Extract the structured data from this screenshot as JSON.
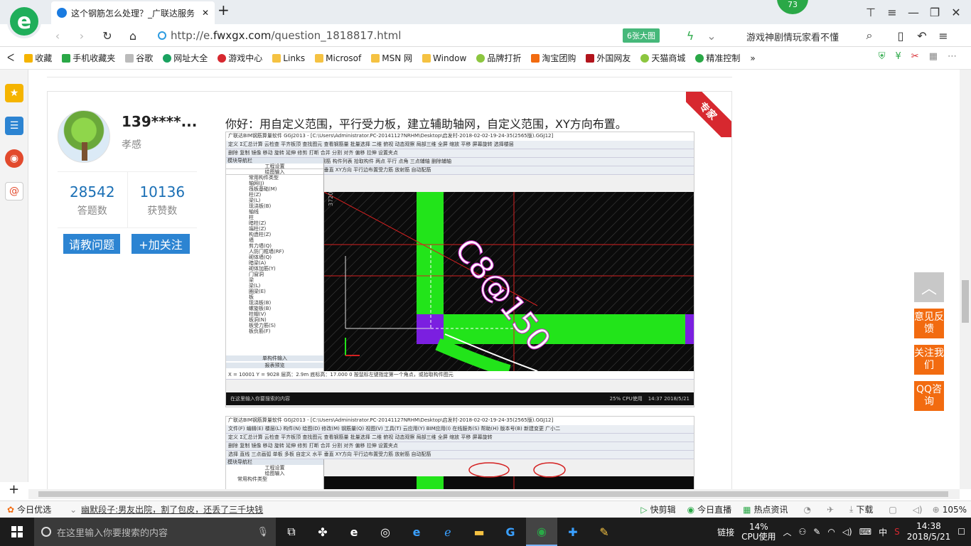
{
  "browser": {
    "tab_title": "这个钢筋怎么处理？_广联达服务",
    "tab_close": "✕",
    "new_tab": "+",
    "badge": "73",
    "url_prefix": "http://e.",
    "url_domain": "fwxgx.com",
    "url_path": "/question_1818817.html",
    "images_count": "6张大图",
    "search_hint": "游戏神剧情玩家看不懂"
  },
  "bookmarks": [
    {
      "label": "收藏",
      "color": "#f5b400"
    },
    {
      "label": "手机收藏夹",
      "color": "#2aa847"
    },
    {
      "label": "谷歌",
      "color": "#999999"
    },
    {
      "label": "网址大全",
      "color": "#1aa260"
    },
    {
      "label": "游戏中心",
      "color": "#d7282f"
    },
    {
      "label": "Links",
      "color": "#f5c242"
    },
    {
      "label": "Microsof",
      "color": "#f5c242"
    },
    {
      "label": "MSN 网",
      "color": "#f5c242"
    },
    {
      "label": "Window",
      "color": "#f5c242"
    },
    {
      "label": "品牌打折",
      "color": "#8cc63f"
    },
    {
      "label": "淘宝团购",
      "color": "#f26b10"
    },
    {
      "label": "外国网友",
      "color": "#b2141c"
    },
    {
      "label": "天猫商城",
      "color": "#8cc63f"
    },
    {
      "label": "精准控制",
      "color": "#2aa847"
    }
  ],
  "bookmarks_more": "»",
  "answer": {
    "username": "139****...",
    "location": "孝感",
    "expert_label": "专家",
    "answers_count": "28542",
    "answers_label": "答题数",
    "likes_count": "10136",
    "likes_label": "获赞数",
    "ask_button": "请教问题",
    "follow_button": "+加关注",
    "text": "你好：用自定义范围，平行受力板，建立辅助轴网，自定义范围，XY方向布置。"
  },
  "screenshot1": {
    "title": "广联达BIM钢筋算量软件 GGJ2013 - [C:\\Users\\Administrator.PC-20141127NRHM\\Desktop\\启发村-2018-02-02-19-24-35(2565版).GGJ12]",
    "toolbar1": "定义  Σ汇总计算  云检查  平齐板顶  查找图元  查看钢筋量  批量选择  二维  俯视  动态观察  局部三维  全屏  缩放  平移  屏幕旋转  选择楼层",
    "toolbar2": "删除  复制  镜像  移动  旋转  延伸  修剪  打断  合并  分割  对齐  偏移  拉伸  设置夹点",
    "toolbar3": "第0层  板  受力筋  SLJ-2  分层板1  属性  编辑钢筋  构件列表  拾取构件  两点  平行  点角  三点辅轴  删除辅轴",
    "toolbar4": "选择  直线  三点画弧  单板  多板  自定义  水平  垂直  XY方向  平行边布置受力筋  放射筋  自动配筋",
    "tree_title": "模块导航栏",
    "tree_tab1": "工程设置",
    "tree_tab2": "绘图输入",
    "tree": [
      "常用构件类型",
      "轴网(J)",
      "筏板基础(M)",
      "柱(Z)",
      "梁(L)",
      "现浇板(B)",
      "轴线",
      "柱",
      "暗柱(Z)",
      "端柱(Z)",
      "构造柱(Z)",
      "墙",
      "剪力墙(Q)",
      "人防门框墙(RF)",
      "砌体墙(Q)",
      "暗梁(A)",
      "砌体加筋(Y)",
      "门窗洞",
      "梁",
      "梁(L)",
      "圈梁(E)",
      "板",
      "现浇板(B)",
      "螺旋板(B)",
      "柱帽(V)",
      "板洞(N)",
      "板受力筋(S)",
      "板负筋(F)"
    ],
    "tree_bottom1": "单构件输入",
    "tree_bottom2": "报表预览",
    "rebar_label": "C8@150",
    "axis_num": "3720",
    "status": "X = 10001  Y = 9028  层高：2.9m  底标高：17.000  0  按鼠标左键指定第一个角点，或拾取构件图元",
    "taskbar": "在这里输入你要搜索的内容",
    "cpu": "25% CPU使用",
    "time": "14:37 2018/5/21"
  },
  "screenshot2": {
    "title": "广联达BIM钢筋算量软件 GGJ2013 - [C:\\Users\\Administrator.PC-20141127NRHM\\Desktop\\启发村-2018-02-02-19-24-35(2565版).GGJ12]",
    "toolbar1": "文件(F)  编辑(E)  楼层(L)  构件(N)  绘图(D)  修改(M)  钢筋量(Q)  视图(V)  工具(T)  云应用(Y)  BIM应用(I)  在线服务(S)  帮助(H)  版本号(B)  新建变更  广小二",
    "toolbar2": "定义  Σ汇总计算  云检查  平齐板顶  查找图元  查看钢筋量  批量选择  二维  俯视  动态观察  局部三维  全屏  缩放  平移  屏幕旋转",
    "toolbar3": "删除  复制  镜像  移动  旋转  延伸  修剪  打断  合并  分割  对齐  偏移  拉伸  设置夹点",
    "toolbar4": "选择  直线  三点画弧  单板  多板  自定义  水平  垂直  XY方向  平行边布置受力筋  放射筋  自动配筋",
    "tree_title": "模块导航栏",
    "tree_tab1": "工程设置",
    "tree_tab2": "绘图输入",
    "tree": [
      "常用构件类型"
    ]
  },
  "right_buttons": {
    "feedback": "意见反馈",
    "follow": "关注我们",
    "qq": "QQ咨询"
  },
  "statusbar": {
    "today": "今日优选",
    "news": "幽默段子:男友出院，割了包皮，还丢了三千块钱",
    "kuaijian": "快剪辑",
    "live": "今日直播",
    "hot": "热点资讯",
    "download": "下载",
    "zoom": "105%"
  },
  "taskbar": {
    "search": "在这里输入你要搜索的内容",
    "link": "链接",
    "cpu_pct": "14%",
    "cpu_label": "CPU使用",
    "ime": "中",
    "time": "14:38",
    "date": "2018/5/21"
  }
}
